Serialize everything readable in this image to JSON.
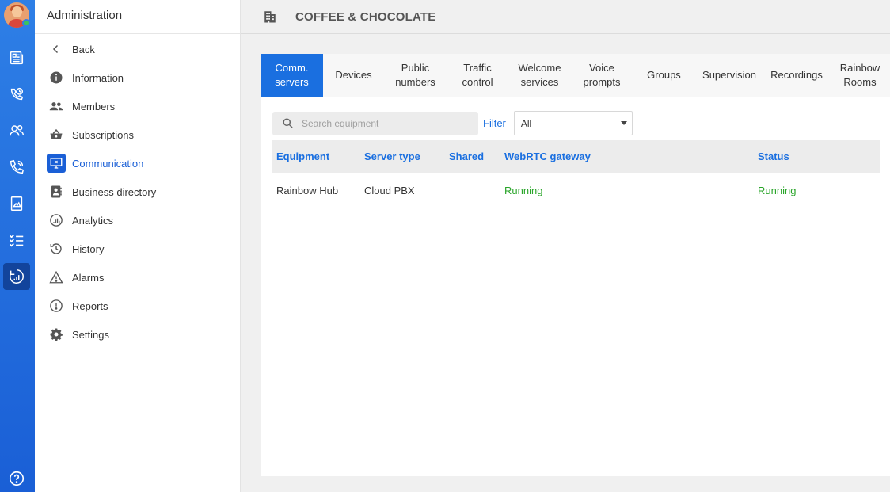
{
  "sidebar": {
    "title": "Administration",
    "items": [
      {
        "label": "Back",
        "icon": "chevron-left-icon"
      },
      {
        "label": "Information",
        "icon": "info-icon"
      },
      {
        "label": "Members",
        "icon": "members-icon"
      },
      {
        "label": "Subscriptions",
        "icon": "basket-icon"
      },
      {
        "label": "Communication",
        "icon": "communication-icon",
        "active": true
      },
      {
        "label": "Business directory",
        "icon": "directory-icon"
      },
      {
        "label": "Analytics",
        "icon": "analytics-icon"
      },
      {
        "label": "History",
        "icon": "history-icon"
      },
      {
        "label": "Alarms",
        "icon": "warning-icon"
      },
      {
        "label": "Reports",
        "icon": "report-icon"
      },
      {
        "label": "Settings",
        "icon": "gear-icon"
      }
    ]
  },
  "header": {
    "title": "COFFEE & CHOCOLATE",
    "icon": "building-icon"
  },
  "tabs": [
    {
      "label": "Comm. servers",
      "active": true
    },
    {
      "label": "Devices"
    },
    {
      "label": "Public numbers"
    },
    {
      "label": "Traffic control"
    },
    {
      "label": "Welcome services"
    },
    {
      "label": "Voice prompts"
    },
    {
      "label": "Groups"
    },
    {
      "label": "Supervision"
    },
    {
      "label": "Recordings"
    },
    {
      "label": "Rainbow Rooms"
    }
  ],
  "toolbar": {
    "search_placeholder": "Search equipment",
    "filter_label": "Filter",
    "filter_value": "All"
  },
  "table": {
    "columns": [
      "Equipment",
      "Server type",
      "Shared",
      "WebRTC gateway",
      "Status"
    ],
    "rows": [
      [
        "Rainbow Hub",
        "Cloud PBX",
        "",
        "Running",
        "Running"
      ]
    ]
  },
  "colors": {
    "accent": "#1a6fe0",
    "rail": "#2e7fe6",
    "running": "#2aa52a"
  }
}
